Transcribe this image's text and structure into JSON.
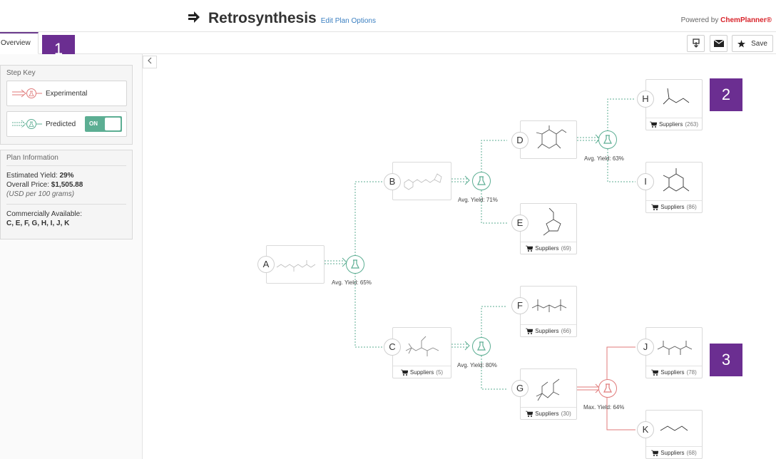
{
  "header": {
    "title": "Retrosynthesis",
    "edit_link": "Edit Plan Options",
    "powered_prefix": "Powered by ",
    "powered_brand": "ChemPlanner®"
  },
  "tabs": {
    "overview": "Overview"
  },
  "badges": {
    "b1": "1",
    "b2": "2",
    "b3": "3"
  },
  "toolbar": {
    "save_label": "Save"
  },
  "colors": {
    "experimental": "#e07a7a",
    "predicted": "#5cae93",
    "accent": "#6b2e91",
    "brand": "#d8232a"
  },
  "step_key": {
    "title": "Step Key",
    "experimental": "Experimental",
    "predicted": "Predicted",
    "toggle": "ON"
  },
  "plan_info": {
    "title": "Plan Information",
    "yield_label": "Estimated Yield:",
    "yield_value": "29%",
    "price_label": "Overall Price:",
    "price_value": "$1,505.88",
    "price_note": "(USD per 100 grams)",
    "commercial_label": "Commercially Available:",
    "commercial_value": "C, E, F, G, H, I, J, K"
  },
  "nodes": {
    "A": {
      "label": "A"
    },
    "B": {
      "label": "B"
    },
    "C": {
      "label": "C",
      "suppliers": "Suppliers",
      "count": "(5)"
    },
    "D": {
      "label": "D"
    },
    "E": {
      "label": "E",
      "suppliers": "Suppliers",
      "count": "(69)"
    },
    "F": {
      "label": "F",
      "suppliers": "Suppliers",
      "count": "(66)"
    },
    "G": {
      "label": "G",
      "suppliers": "Suppliers",
      "count": "(30)"
    },
    "H": {
      "label": "H",
      "suppliers": "Suppliers",
      "count": "(263)"
    },
    "I": {
      "label": "I",
      "suppliers": "Suppliers",
      "count": "(86)"
    },
    "J": {
      "label": "J",
      "suppliers": "Suppliers",
      "count": "(78)"
    },
    "K": {
      "label": "K",
      "suppliers": "Suppliers",
      "count": "(68)"
    }
  },
  "reactions": {
    "r_a": "Avg. Yield: 65%",
    "r_b": "Avg. Yield: 71%",
    "r_c": "Avg. Yield: 80%",
    "r_d": "Avg. Yield: 63%",
    "r_g": "Max. Yield: 64%"
  }
}
